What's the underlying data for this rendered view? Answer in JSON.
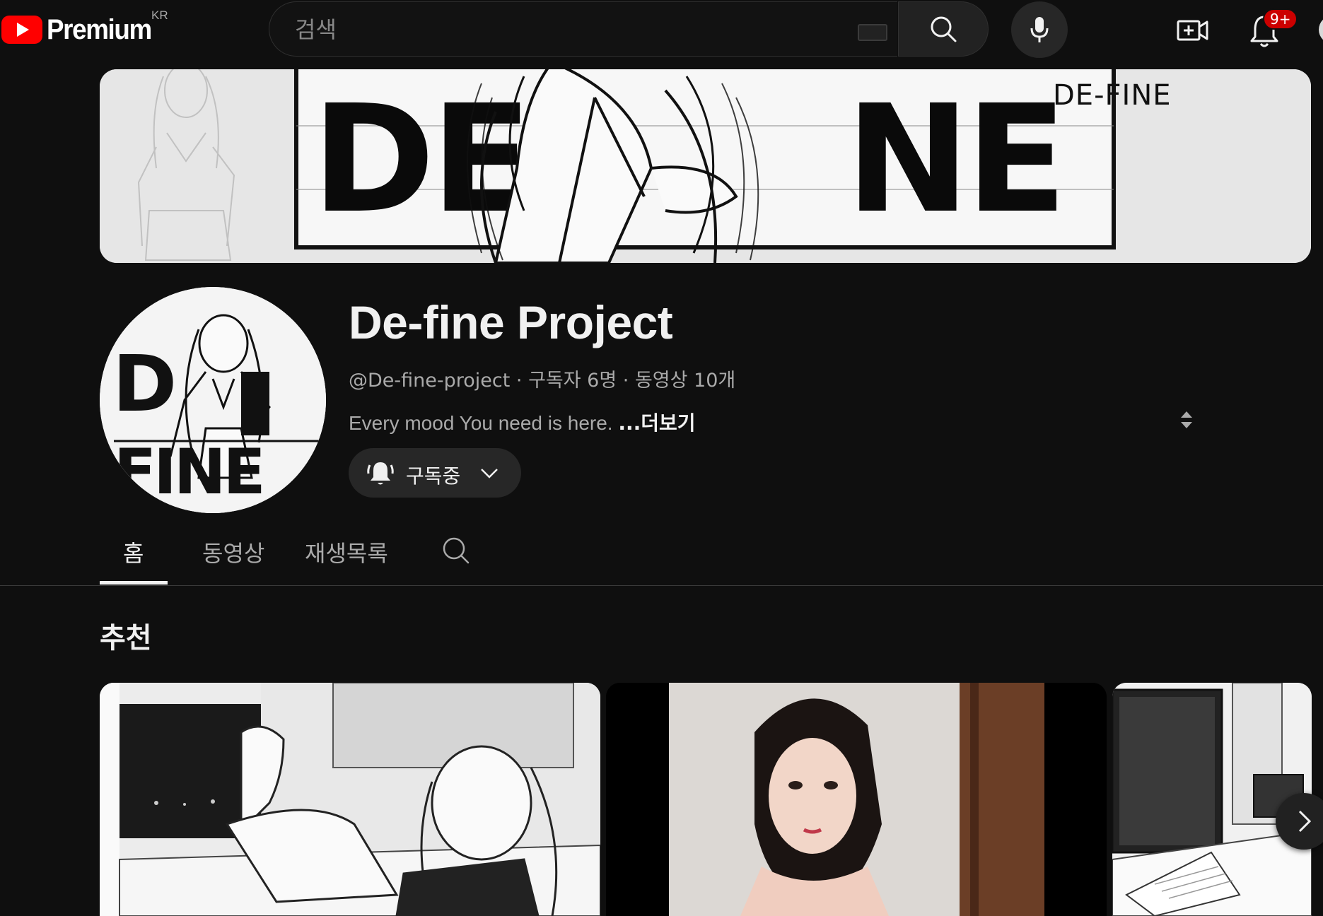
{
  "header": {
    "logo_text": "Premium",
    "country_code": "KR",
    "search_placeholder": "검색",
    "notification_badge": "9+"
  },
  "banner": {
    "logo_text": "DE-FINE"
  },
  "channel": {
    "name": "De-fine Project",
    "meta": "@De-fine-project · 구독자 6명 · 동영상 10개",
    "description": "Every mood You need is here.",
    "more_label": "...더보기",
    "subscribe_label": "구독중"
  },
  "tabs": [
    {
      "label": "홈",
      "active": true
    },
    {
      "label": "동영상",
      "active": false
    },
    {
      "label": "재생목록",
      "active": false
    }
  ],
  "section": {
    "title": "추천"
  },
  "icons": {
    "search": "search-icon",
    "keyboard": "keyboard-icon",
    "mic": "mic-icon",
    "create": "create-video-icon",
    "notifications": "bell-icon",
    "subscribe_bell": "bell-ring-icon",
    "chevron": "chevron-down-icon",
    "next": "chevron-right-icon"
  },
  "colors": {
    "background": "#0f0f0f",
    "brand_red": "#ff0000",
    "badge_red": "#cc0000",
    "text_primary": "#f1f1f1",
    "text_secondary": "#aaaaaa"
  }
}
